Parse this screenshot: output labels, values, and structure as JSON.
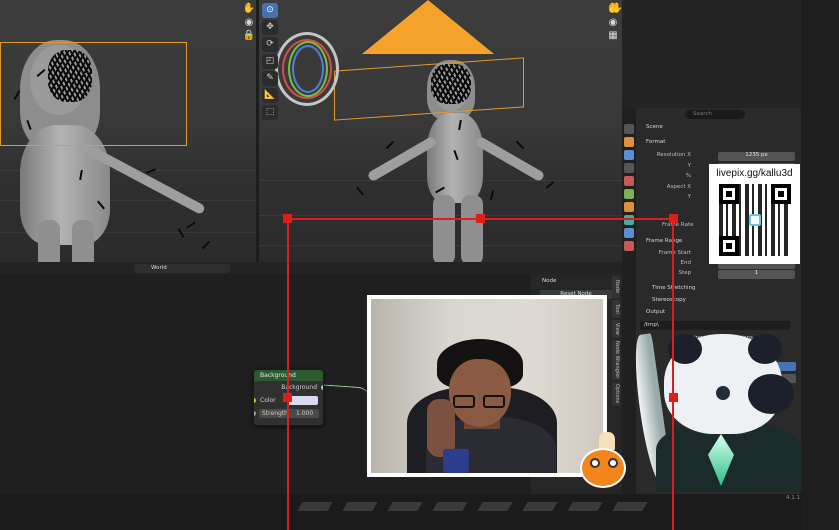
{
  "node_editor": {
    "world_label": "World",
    "sidebar_tab": "Node",
    "reset_node": "Reset Node",
    "vertical_tabs": [
      "Node",
      "Tool",
      "View",
      "Node Wrangler",
      "Options"
    ]
  },
  "node": {
    "title": "Background",
    "output": "Background",
    "color_label": "Color",
    "strength_label": "Strength",
    "strength_value": "1.000"
  },
  "properties": {
    "search_placeholder": "Search",
    "scene_label": "Scene",
    "format_header": "Format",
    "resolution_label": "Resolution X",
    "resolution_value": "1235 px",
    "y_label": "Y",
    "percent_label": "%",
    "aspect_label": "Aspect X",
    "aspect_y_label": "Y",
    "frame_rate_label": "Frame Rate",
    "frame_range_header": "Frame Range",
    "frame_start_label": "Frame Start",
    "end_label": "End",
    "step_label": "Step",
    "step_value": "1",
    "time_stretching": "Time Stretching",
    "stereoscopy": "Stereoscopy",
    "output_header": "Output",
    "output_path": "/tmp\\",
    "saving_label": "Saving",
    "file_extensions": "File Extensions"
  },
  "overlay": {
    "qr_text": "livepix.gg/kallu3d"
  },
  "status": {
    "version": "4.1.1"
  },
  "colors": {
    "accent_blue": "#4772b3",
    "camera_orange": "#f5a22a",
    "selection_orange": "#e39a2c",
    "overlay_red": "#e01d1d",
    "node_header_green": "#2c5a2e"
  },
  "icons": [
    "hand-icon",
    "camera-icon",
    "lock-icon",
    "cursor-icon",
    "move-icon",
    "rotate-icon",
    "scale-icon",
    "transform-icon",
    "annotate-icon",
    "measure-icon"
  ]
}
